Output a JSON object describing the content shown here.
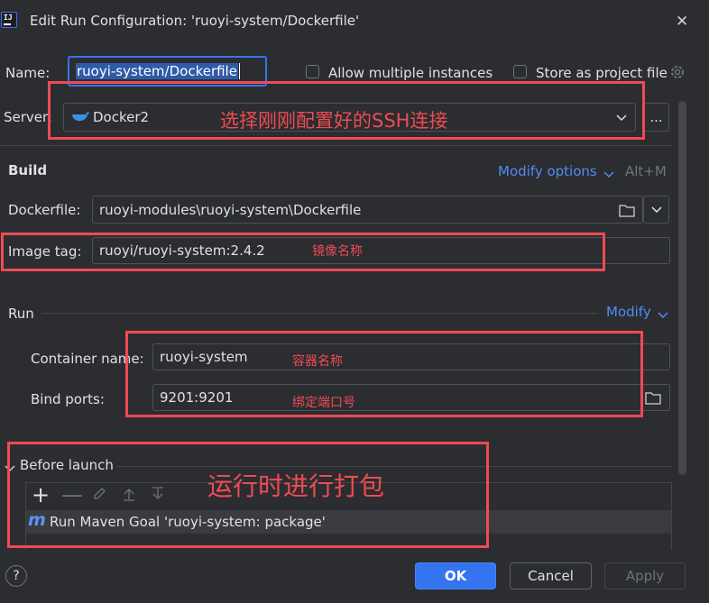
{
  "dialog": {
    "title": "Edit Run Configuration: 'ruoyi-system/Dockerfile'",
    "close_label": "✕"
  },
  "name_row": {
    "label": "Name:",
    "value": "ruoyi-system/Dockerfile",
    "allow_multiple": "Allow multiple instances",
    "store_as_project": "Store as project file"
  },
  "server": {
    "label": "Server:",
    "value": "Docker2",
    "more_label": "..."
  },
  "build": {
    "heading": "Build",
    "modify_options": "Modify options",
    "shortcut": "Alt+M",
    "dockerfile_label": "Dockerfile:",
    "dockerfile_value": "ruoyi-modules\\ruoyi-system\\Dockerfile",
    "image_tag_label": "Image tag:",
    "image_tag_value": "ruoyi/ruoyi-system:2.4.2"
  },
  "run": {
    "heading": "Run",
    "modify": "Modify",
    "container_label": "Container name:",
    "container_value": "ruoyi-system",
    "ports_label": "Bind ports:",
    "ports_value": "9201:9201"
  },
  "before_launch": {
    "heading": "Before launch",
    "task_icon_text": "m",
    "task": "Run Maven Goal 'ruoyi-system: package'"
  },
  "footer": {
    "help": "?",
    "ok": "OK",
    "cancel": "Cancel",
    "apply": "Apply"
  },
  "annotations": {
    "server_note": "选择刚刚配置好的SSH连接",
    "image_note": "镜像名称",
    "container_note": "容器名称",
    "ports_note": "绑定端口号",
    "launch_note": "运行时进行打包"
  },
  "colors": {
    "background": "#2b2d30",
    "accent": "#548af7",
    "annotation": "#ee4b54",
    "primary_button": "#3574f0"
  }
}
